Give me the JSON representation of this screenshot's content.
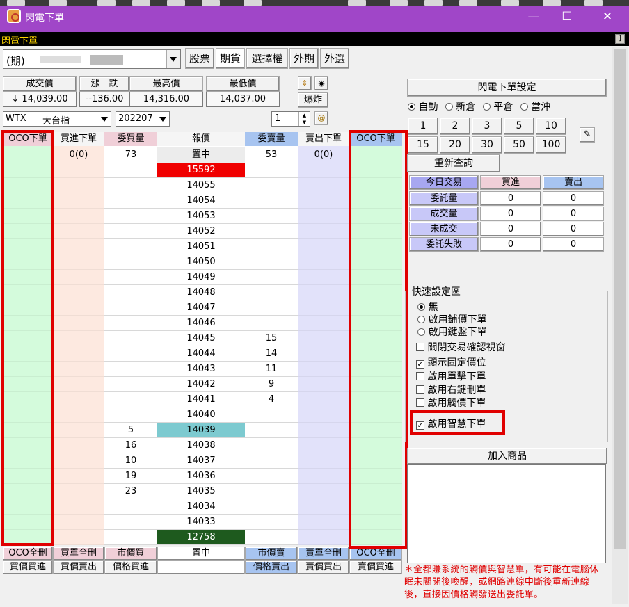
{
  "window": {
    "title": "閃電下單",
    "menu_label": "閃電下單"
  },
  "product": {
    "selected": "(期)",
    "tabs": [
      "股票",
      "期貨",
      "選擇權",
      "外期",
      "外選"
    ]
  },
  "quote": {
    "headers": [
      "成交價",
      "漲　跌",
      "最高價",
      "最低價"
    ],
    "values": [
      "↓ 14,039.00",
      "--136.00",
      "14,316.00",
      "14,037.00"
    ]
  },
  "tools": {
    "explode_label": "爆炸"
  },
  "contract": {
    "symbol": "WTX",
    "name": "大台指",
    "month": "202207",
    "qty": "1"
  },
  "ladder": {
    "headers": [
      "OCO下單",
      "買進下單",
      "委買量",
      "報價",
      "委賣量",
      "賣出下單",
      "OCO下單"
    ],
    "summary": {
      "buy_order": "0(0)",
      "bid_total": "73",
      "center": "置中",
      "ask_total": "53",
      "sell_order": "0(0)"
    },
    "rows": [
      {
        "price": "15592",
        "bid": "",
        "ask": "",
        "style": "limit-up"
      },
      {
        "price": "14055",
        "bid": "",
        "ask": ""
      },
      {
        "price": "14054",
        "bid": "",
        "ask": ""
      },
      {
        "price": "14053",
        "bid": "",
        "ask": ""
      },
      {
        "price": "14052",
        "bid": "",
        "ask": ""
      },
      {
        "price": "14051",
        "bid": "",
        "ask": ""
      },
      {
        "price": "14050",
        "bid": "",
        "ask": ""
      },
      {
        "price": "14049",
        "bid": "",
        "ask": ""
      },
      {
        "price": "14048",
        "bid": "",
        "ask": ""
      },
      {
        "price": "14047",
        "bid": "",
        "ask": ""
      },
      {
        "price": "14046",
        "bid": "",
        "ask": ""
      },
      {
        "price": "14045",
        "bid": "",
        "ask": "15"
      },
      {
        "price": "14044",
        "bid": "",
        "ask": "14"
      },
      {
        "price": "14043",
        "bid": "",
        "ask": "11"
      },
      {
        "price": "14042",
        "bid": "",
        "ask": "9"
      },
      {
        "price": "14041",
        "bid": "",
        "ask": "4"
      },
      {
        "price": "14040",
        "bid": "",
        "ask": ""
      },
      {
        "price": "14039",
        "bid": "5",
        "ask": "",
        "style": "last"
      },
      {
        "price": "14038",
        "bid": "16",
        "ask": ""
      },
      {
        "price": "14037",
        "bid": "10",
        "ask": ""
      },
      {
        "price": "14036",
        "bid": "19",
        "ask": ""
      },
      {
        "price": "14035",
        "bid": "23",
        "ask": ""
      },
      {
        "price": "14034",
        "bid": "",
        "ask": ""
      },
      {
        "price": "14033",
        "bid": "",
        "ask": ""
      },
      {
        "price": "12758",
        "bid": "",
        "ask": "",
        "style": "limit-down"
      }
    ],
    "footer1": [
      "OCO全刪",
      "買單全刪",
      "市價買",
      "置中",
      "市價賣",
      "賣單全刪",
      "OCO全刪"
    ],
    "footer2": [
      "買價買進",
      "買價賣出",
      "價格買進",
      "",
      "價格賣出",
      "賣價買出",
      "賣價買進"
    ]
  },
  "settings": {
    "title": "閃電下單設定",
    "modes": [
      "自動",
      "新倉",
      "平倉",
      "當沖"
    ],
    "qty_buttons": [
      "1",
      "2",
      "3",
      "5",
      "10",
      "15",
      "20",
      "30",
      "50",
      "100"
    ],
    "requery": "重新查詢"
  },
  "today": {
    "headers": [
      "今日交易",
      "買進",
      "賣出"
    ],
    "rows": [
      {
        "label": "委託量",
        "buy": "0",
        "sell": "0"
      },
      {
        "label": "成交量",
        "buy": "0",
        "sell": "0"
      },
      {
        "label": "未成交",
        "buy": "0",
        "sell": "0"
      },
      {
        "label": "委託失敗",
        "buy": "0",
        "sell": "0"
      }
    ]
  },
  "quick": {
    "title": "快速設定區",
    "radios": [
      "無",
      "啟用鋪價下單",
      "啟用鍵盤下單"
    ],
    "checks": [
      {
        "label": "關閉交易確認視窗",
        "checked": false
      },
      {
        "label": "顯示固定價位",
        "checked": true
      },
      {
        "label": "啟用單擊下單",
        "checked": false
      },
      {
        "label": "啟用右鍵刪單",
        "checked": false
      },
      {
        "label": "啟用觸價下單",
        "checked": false
      },
      {
        "label": "啟用智慧下單",
        "checked": true
      }
    ]
  },
  "add_product": "加入商品",
  "warning": "＊全都賺系統的觸價與智慧單，有可能在電腦休眠未關閉後喚醒，或網路連線中斷後重新連線後，直接因價格觸發送出委託單。",
  "colors": {
    "title_bar": "#a046c8",
    "oco": "#d4fbdc",
    "buy": "#fde9e0",
    "sell": "#e2e2fa",
    "red": "#e00000",
    "last": "#7dcad0",
    "limit_down": "#1e5a1e",
    "ask_header": "#a7c4f0",
    "bid_header": "#f0cfd8"
  }
}
